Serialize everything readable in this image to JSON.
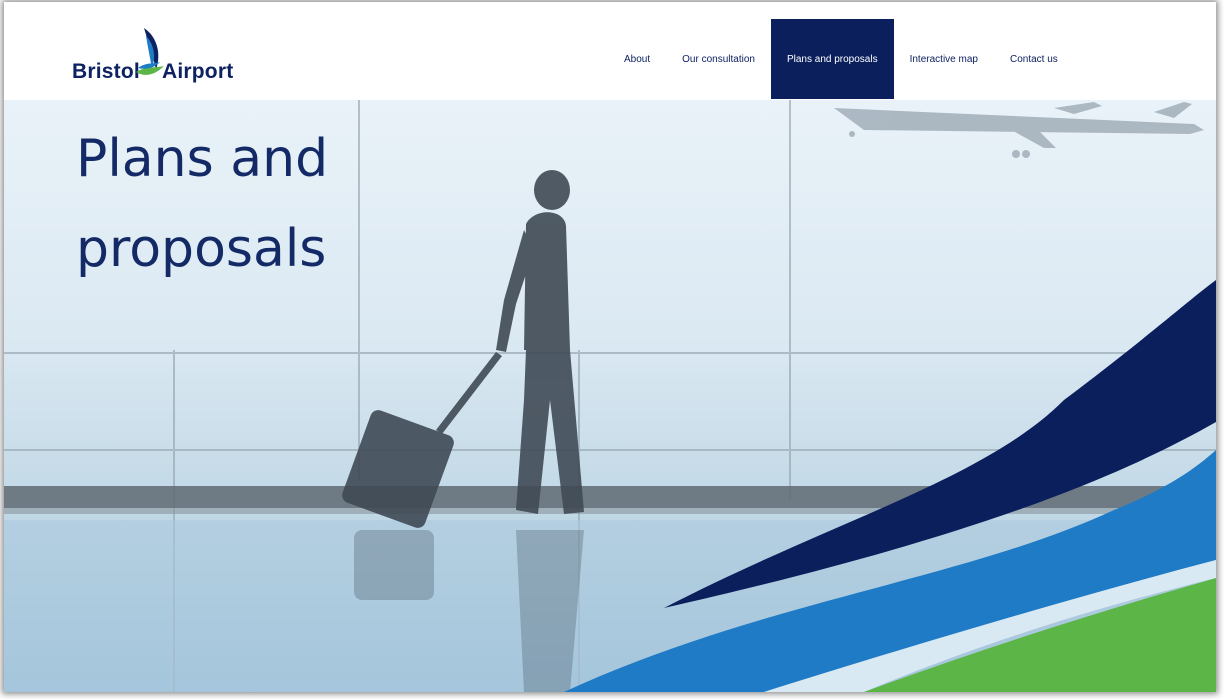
{
  "brand": {
    "name_left": "Bristol",
    "name_right": "Airport",
    "logo_icon": "bird-sail-logo-icon",
    "colors": {
      "navy": "#0e2262",
      "blue": "#1e7cc4",
      "green": "#5cb547"
    }
  },
  "nav": {
    "items": [
      {
        "label": "About"
      },
      {
        "label": "Our consultation"
      },
      {
        "label": "Plans and proposals",
        "active": true
      },
      {
        "label": "Interactive map"
      },
      {
        "label": "Contact us"
      }
    ]
  },
  "hero": {
    "title_line1": "Plans and",
    "title_line2": "proposals",
    "image": "traveller-with-suitcase-at-airport-window"
  }
}
